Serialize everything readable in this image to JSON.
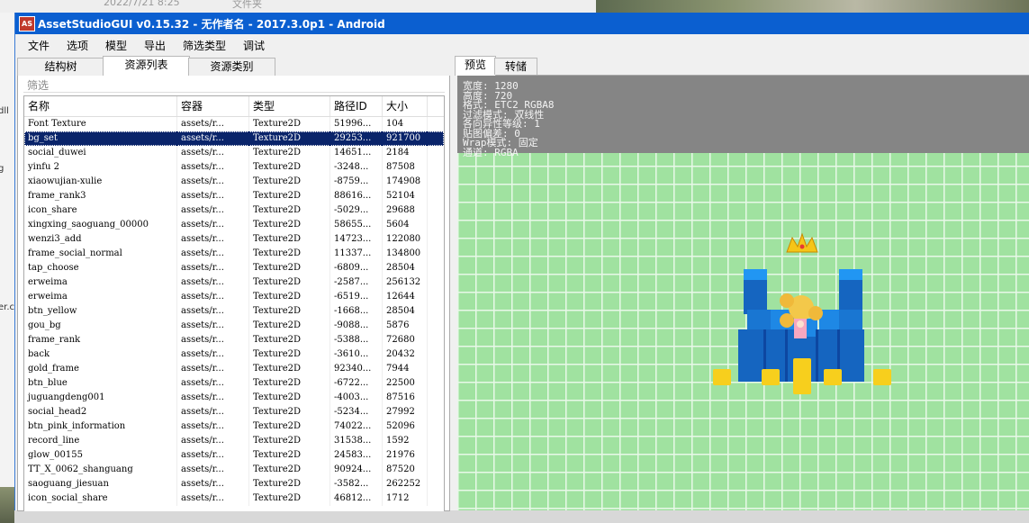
{
  "desktop": {
    "date_text": "2022/7/21 8:25",
    "folder_text": "文件夹",
    "left_snippet_1": "dll",
    "left_snippet_2": "g",
    "left_snippet_3": "er.c"
  },
  "window": {
    "icon_text": "AS",
    "title": "AssetStudioGUI v0.15.32 - 无作者名 - 2017.3.0p1 - Android"
  },
  "menu": [
    "文件",
    "选项",
    "模型",
    "导出",
    "筛选类型",
    "调试"
  ],
  "left_tabs": [
    "结构树",
    "资源列表",
    "资源类别"
  ],
  "left_active_tab": 1,
  "filter_label": "筛选",
  "columns": [
    "名称",
    "容器",
    "类型",
    "路径ID",
    "大小"
  ],
  "rows": [
    [
      "Font Texture",
      "assets/r...",
      "Texture2D",
      "51996...",
      "104"
    ],
    [
      "bg_set",
      "assets/r...",
      "Texture2D",
      "29253...",
      "921700"
    ],
    [
      "social_duwei",
      "assets/r...",
      "Texture2D",
      "14651...",
      "2184"
    ],
    [
      "yinfu 2",
      "assets/r...",
      "Texture2D",
      "-3248...",
      "87508"
    ],
    [
      "xiaowujian-xulie",
      "assets/r...",
      "Texture2D",
      "-8759...",
      "174908"
    ],
    [
      "frame_rank3",
      "assets/r...",
      "Texture2D",
      "88616...",
      "52104"
    ],
    [
      "icon_share",
      "assets/r...",
      "Texture2D",
      "-5029...",
      "29688"
    ],
    [
      "xingxing_saoguang_00000",
      "assets/r...",
      "Texture2D",
      "58655...",
      "5604"
    ],
    [
      "wenzi3_add",
      "assets/r...",
      "Texture2D",
      "14723...",
      "122080"
    ],
    [
      "frame_social_normal",
      "assets/r...",
      "Texture2D",
      "11337...",
      "134800"
    ],
    [
      "tap_choose",
      "assets/r...",
      "Texture2D",
      "-6809...",
      "28504"
    ],
    [
      "erweima",
      "assets/r...",
      "Texture2D",
      "-2587...",
      "256132"
    ],
    [
      "erweima",
      "assets/r...",
      "Texture2D",
      "-6519...",
      "12644"
    ],
    [
      "btn_yellow",
      "assets/r...",
      "Texture2D",
      "-1668...",
      "28504"
    ],
    [
      "gou_bg",
      "assets/r...",
      "Texture2D",
      "-9088...",
      "5876"
    ],
    [
      "frame_rank",
      "assets/r...",
      "Texture2D",
      "-5388...",
      "72680"
    ],
    [
      "back",
      "assets/r...",
      "Texture2D",
      "-3610...",
      "20432"
    ],
    [
      "gold_frame",
      "assets/r...",
      "Texture2D",
      "92340...",
      "7944"
    ],
    [
      "btn_blue",
      "assets/r...",
      "Texture2D",
      "-6722...",
      "22500"
    ],
    [
      "juguangdeng001",
      "assets/r...",
      "Texture2D",
      "-4003...",
      "87516"
    ],
    [
      "social_head2",
      "assets/r...",
      "Texture2D",
      "-5234...",
      "27992"
    ],
    [
      "btn_pink_information",
      "assets/r...",
      "Texture2D",
      "74022...",
      "52096"
    ],
    [
      "record_line",
      "assets/r...",
      "Texture2D",
      "31538...",
      "1592"
    ],
    [
      "glow_00155",
      "assets/r...",
      "Texture2D",
      "24583...",
      "21976"
    ],
    [
      "TT_X_0062_shanguang",
      "assets/r...",
      "Texture2D",
      "90924...",
      "87520"
    ],
    [
      "saoguang_jiesuan",
      "assets/r...",
      "Texture2D",
      "-3582...",
      "262252"
    ],
    [
      "icon_social_share",
      "assets/r...",
      "Texture2D",
      "46812...",
      "1712"
    ]
  ],
  "selected_row": 1,
  "right_tabs": [
    "预览",
    "转储"
  ],
  "right_active_tab": 0,
  "texture_info": [
    "宽度: 1280",
    "高度: 720",
    "格式: ETC2_RGBA8",
    "过滤模式: 双线性",
    "各向异性等级: 1",
    "贴图偏差: 0",
    "Wrap模式: 固定",
    "通道: RGBA"
  ],
  "colors": {
    "titlebar": "#0b5fd0",
    "selection": "#0a246a",
    "preview_bg": "#a0e2a0",
    "grid_line": "#e8f8e8",
    "blue_block": "#1877e0",
    "gold": "#f0c400"
  }
}
